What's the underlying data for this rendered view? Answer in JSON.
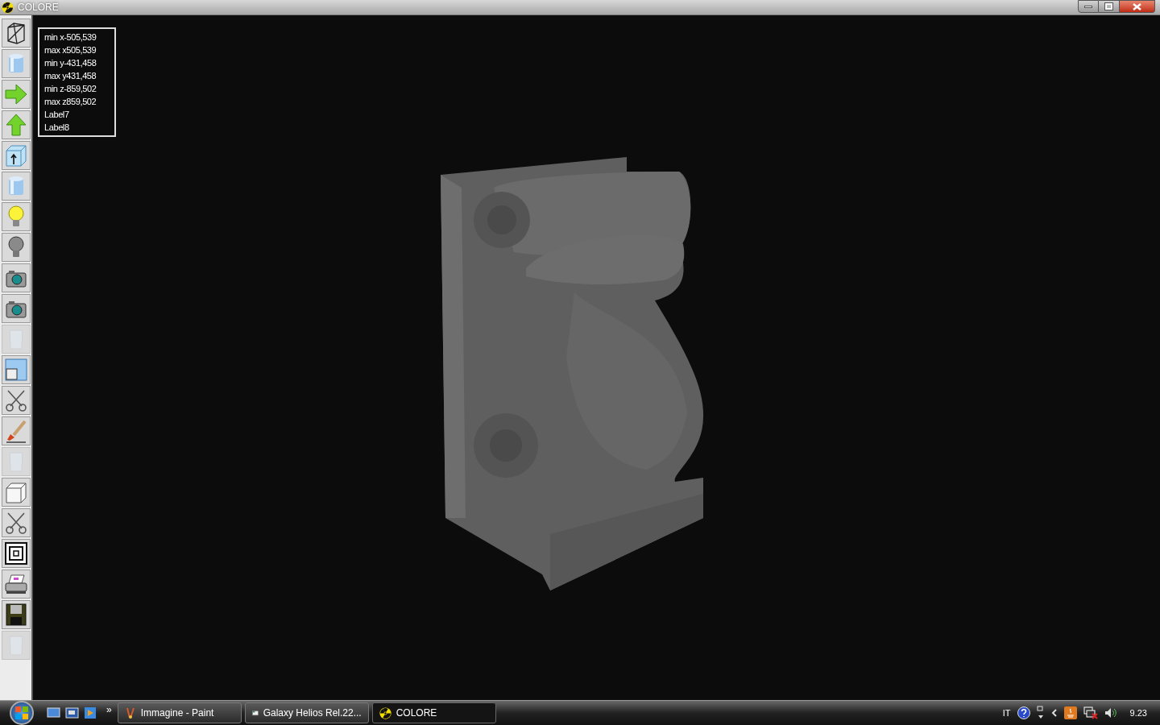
{
  "window": {
    "title": "COLORE"
  },
  "toolbar": [
    {
      "kind": "wireframe",
      "disabled": false
    },
    {
      "kind": "cylinder",
      "disabled": false
    },
    {
      "kind": "arrow-right",
      "disabled": false
    },
    {
      "kind": "arrow-up",
      "disabled": false
    },
    {
      "kind": "box-arrow",
      "disabled": false
    },
    {
      "kind": "cylinder",
      "disabled": false
    },
    {
      "kind": "bulb-on",
      "disabled": false
    },
    {
      "kind": "bulb-off",
      "disabled": false
    },
    {
      "kind": "camera",
      "disabled": false
    },
    {
      "kind": "camera",
      "disabled": false
    },
    {
      "kind": "glass",
      "disabled": true
    },
    {
      "kind": "window",
      "disabled": false
    },
    {
      "kind": "scissors",
      "disabled": false
    },
    {
      "kind": "brush",
      "disabled": false
    },
    {
      "kind": "glass",
      "disabled": true
    },
    {
      "kind": "cube",
      "disabled": false
    },
    {
      "kind": "scissors",
      "disabled": false
    },
    {
      "kind": "concentric",
      "disabled": false
    },
    {
      "kind": "printer",
      "disabled": false
    },
    {
      "kind": "floppy",
      "disabled": false
    },
    {
      "kind": "glass",
      "disabled": true
    }
  ],
  "info_labels": [
    "min x-505,539",
    "max x505,539",
    "min y-431,458",
    "max y431,458",
    "min z-859,502",
    "max z859,502",
    "Label7",
    "Label8"
  ],
  "taskbar": {
    "overflow": "»",
    "tasks": [
      {
        "label": "Immagine - Paint",
        "kind": "paint",
        "selected": false
      },
      {
        "label": "Galaxy Helios  Rel.22...",
        "kind": "helios",
        "selected": false
      },
      {
        "label": "COLORE",
        "kind": "colore",
        "selected": true
      }
    ],
    "language": "IT",
    "clock": "9.23"
  }
}
